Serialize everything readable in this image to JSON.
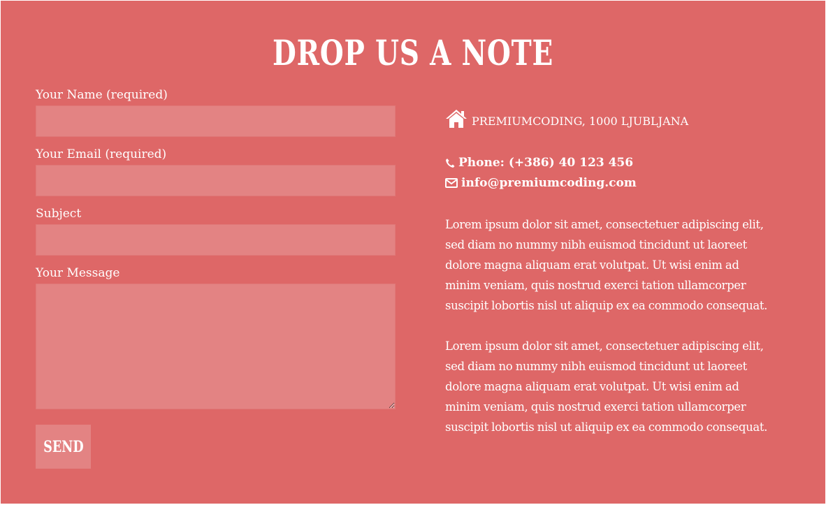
{
  "section_title": "DROP US A NOTE",
  "form": {
    "name_label": "Your Name (required)",
    "email_label": "Your Email (required)",
    "subject_label": "Subject",
    "message_label": "Your Message",
    "name_value": "",
    "email_value": "",
    "subject_value": "",
    "message_value": "",
    "send_label": "SEND"
  },
  "contact": {
    "address": "PREMIUMCODING, 1000 LJUBLJANA",
    "address_icon": "home-icon",
    "phone": "Phone: (+386) 40 123 456",
    "phone_icon": "phone-icon",
    "email": "info@premiumcoding.com",
    "email_icon": "envelope-icon"
  },
  "paragraphs": [
    "Lorem ipsum dolor sit amet, consectetuer adipiscing elit, sed diam no nummy nibh euismod tincidunt ut laoreet dolore magna aliquam erat volutpat. Ut wisi enim ad minim veniam, quis nostrud exerci tation ullamcorper suscipit lobortis nisl ut aliquip ex ea commodo consequat.",
    "Lorem ipsum dolor sit amet, consectetuer adipiscing elit, sed diam no nummy nibh euismod tincidunt ut laoreet dolore magna aliquam erat volutpat. Ut wisi enim ad minim veniam, quis nostrud exerci tation ullamcorper suscipit lobortis nisl ut aliquip ex ea commodo consequat."
  ],
  "colors": {
    "background": "#de6767",
    "field_background": "#e38383",
    "text": "#ffffff"
  }
}
